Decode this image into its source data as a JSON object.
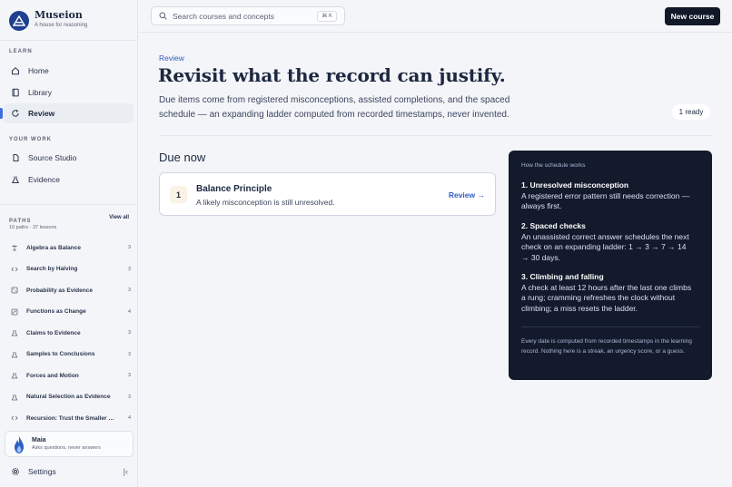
{
  "brand": {
    "name": "Museion",
    "tagline": "A house for reasoning"
  },
  "sidebar": {
    "learn_label": "LEARN",
    "nav": [
      {
        "label": "Home",
        "icon": "home-icon"
      },
      {
        "label": "Library",
        "icon": "book-icon"
      },
      {
        "label": "Review",
        "icon": "review-icon",
        "active": true
      }
    ],
    "work_label": "YOUR WORK",
    "work": [
      {
        "label": "Source Studio",
        "icon": "studio-icon"
      },
      {
        "label": "Evidence",
        "icon": "evidence-icon"
      }
    ],
    "paths_label": "PATHS",
    "view_all": "View all",
    "paths_summary": "10 paths · 37 lessons",
    "paths": [
      {
        "label": "Algebra as Balance",
        "count": "3",
        "icon": "scale-icon"
      },
      {
        "label": "Search by Halving",
        "count": "3",
        "icon": "code-icon"
      },
      {
        "label": "Probability as Evidence",
        "count": "3",
        "icon": "dice-icon"
      },
      {
        "label": "Functions as Change",
        "count": "4",
        "icon": "chart-icon"
      },
      {
        "label": "Claims to Evidence",
        "count": "3",
        "icon": "flask-icon"
      },
      {
        "label": "Samples to Conclusions",
        "count": "3",
        "icon": "flask-icon"
      },
      {
        "label": "Forces and Motion",
        "count": "3",
        "icon": "flask-icon"
      },
      {
        "label": "Natural Selection as Evidence",
        "count": "3",
        "icon": "flask-icon"
      },
      {
        "label": "Recursion: Trust the Smaller Case",
        "count": "4",
        "icon": "code-icon"
      }
    ],
    "assistant": {
      "name": "Maia",
      "subtitle": "Asks questions, never answers"
    },
    "settings_label": "Settings"
  },
  "topbar": {
    "search_placeholder": "Search courses and concepts",
    "search_shortcut": "⌘ K",
    "new_course_label": "New course"
  },
  "main": {
    "eyebrow": "Review",
    "headline": "Revisit what the record can justify.",
    "lede": "Due items come from registered misconceptions, assisted completions, and the spaced schedule — an expanding ladder computed from recorded timestamps, never invented.",
    "ready_badge": "1 ready",
    "due_heading": "Due now",
    "due_items": [
      {
        "number": "1",
        "title": "Balance Principle",
        "subtitle": "A likely misconception is still unresolved.",
        "action": "Review →"
      }
    ]
  },
  "how": {
    "heading": "How the schedule works",
    "steps": [
      {
        "title": "1. Unresolved misconception",
        "body": "A registered error pattern still needs correction — always first."
      },
      {
        "title": "2. Spaced checks",
        "body": "An unassisted correct answer schedules the next check on an expanding ladder: 1 → 3 → 7 → 14 → 30 days."
      },
      {
        "title": "3. Climbing and falling",
        "body": "A check at least 12 hours after the last one climbs a rung; cramming refreshes the clock without climbing; a miss resets the ladder."
      }
    ],
    "footnote": "Every date is computed from recorded timestamps in the learning record. Nothing here is a streak, an urgency score, or a guess."
  },
  "colors": {
    "accent": "#2f5fc4",
    "brand": "#1f3f8f",
    "panel": "#131a2b",
    "primary_button": "#111827"
  }
}
